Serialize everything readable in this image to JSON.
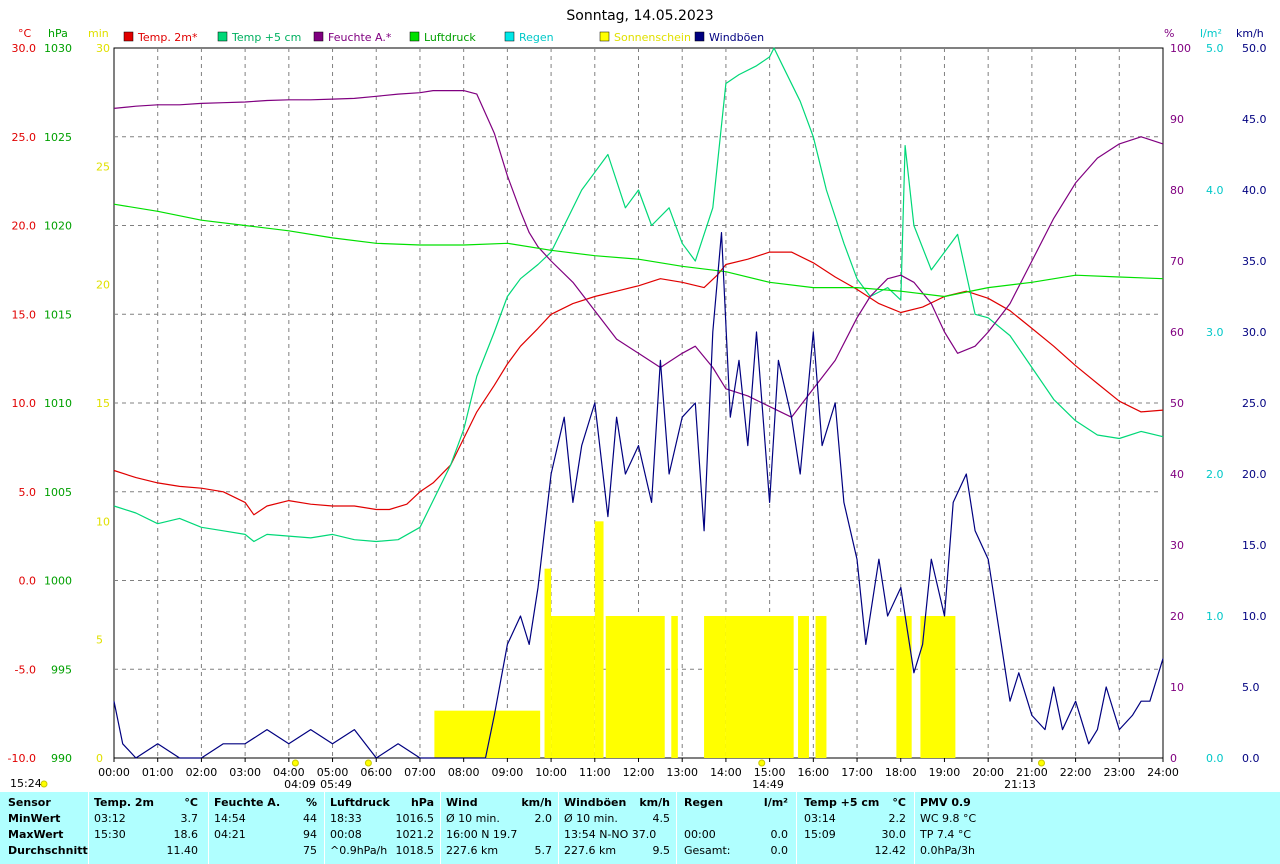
{
  "title": "Sonntag, 14.05.2023",
  "colors": {
    "temp": "#e00000",
    "temp5": "#00d878",
    "humidity": "#800080",
    "pressure": "#00e000",
    "rain": "#00e0e0",
    "sun": "#ffff00",
    "gust": "#000080",
    "min": "#e0e000",
    "grid": "#808080"
  },
  "axis_labels": {
    "temp": "°C",
    "pressure": "hPa",
    "sun": "min",
    "humidity": "%",
    "rain": "l/m²",
    "wind": "km/h"
  },
  "legend": [
    {
      "label": "Temp. 2m*",
      "color": "#e00000",
      "text_color": "#e00000"
    },
    {
      "label": "Temp +5 cm",
      "color": "#00d878",
      "text_color": "#00b060"
    },
    {
      "label": "Feuchte A.*",
      "color": "#800080",
      "text_color": "#800080"
    },
    {
      "label": "Luftdruck",
      "color": "#00e000",
      "text_color": "#00a000"
    },
    {
      "label": "Regen",
      "color": "#00e8e8",
      "text_color": "#00c8c8"
    },
    {
      "label": "Sonnenschein",
      "color": "#ffff00",
      "text_color": "#e0e000"
    },
    {
      "label": "Windböen",
      "color": "#000080",
      "text_color": "#000080"
    }
  ],
  "left_time_label": "15:24",
  "astro_labels": [
    "04:09",
    "05:49",
    "14:49",
    "21:13"
  ],
  "chart_data": {
    "type": "line",
    "title": "Sonntag, 14.05.2023",
    "x_ticks": [
      "00:00",
      "01:00",
      "02:00",
      "03:00",
      "04:00",
      "05:00",
      "06:00",
      "07:00",
      "08:00",
      "09:00",
      "10:00",
      "11:00",
      "12:00",
      "13:00",
      "14:00",
      "15:00",
      "16:00",
      "17:00",
      "18:00",
      "19:00",
      "20:00",
      "21:00",
      "22:00",
      "23:00",
      "24:00"
    ],
    "x_range_hours": [
      0,
      24
    ],
    "grid": true,
    "legend_position": "top",
    "axes": {
      "temp": {
        "unit": "°C",
        "range": [
          -10,
          30
        ],
        "ticks": [
          "30.0",
          "25.0",
          "20.0",
          "15.0",
          "10.0",
          "5.0",
          "0.0",
          "-5.0",
          "-10.0"
        ]
      },
      "pressure": {
        "unit": "hPa",
        "range": [
          990,
          1030
        ],
        "ticks": [
          "1030",
          "1025",
          "1020",
          "1015",
          "1010",
          "1005",
          "1000",
          "995",
          "990"
        ]
      },
      "sun": {
        "unit": "min",
        "range": [
          0,
          30
        ],
        "ticks": [
          "30",
          "25",
          "20",
          "15",
          "10",
          "5",
          "0"
        ]
      },
      "humidity": {
        "unit": "%",
        "range": [
          0,
          100
        ],
        "ticks": [
          "100",
          "90",
          "80",
          "70",
          "60",
          "50",
          "40",
          "30",
          "20",
          "10",
          "0"
        ]
      },
      "rain": {
        "unit": "l/m²",
        "range": [
          0,
          5
        ],
        "ticks": [
          "5.0",
          "4.0",
          "3.0",
          "2.0",
          "1.0",
          "0.0"
        ]
      },
      "wind": {
        "unit": "km/h",
        "range": [
          0,
          50
        ],
        "ticks": [
          "50.0",
          "45.0",
          "40.0",
          "35.0",
          "30.0",
          "25.0",
          "20.0",
          "15.0",
          "10.0",
          "5.0",
          "0.0"
        ]
      }
    },
    "series": [
      {
        "name": "Temp. 2m*",
        "axis": "temp",
        "hours": [
          0,
          0.5,
          1,
          1.5,
          2,
          2.5,
          3,
          3.2,
          3.5,
          4,
          4.5,
          5,
          5.5,
          6,
          6.3,
          6.7,
          7,
          7.3,
          7.7,
          8,
          8.3,
          8.7,
          9,
          9.3,
          9.7,
          10,
          10.5,
          11,
          11.5,
          12,
          12.5,
          13,
          13.5,
          13.8,
          14,
          14.5,
          15,
          15.5,
          16,
          16.5,
          17,
          17.5,
          18,
          18.5,
          19,
          19.5,
          20,
          20.5,
          21,
          21.5,
          22,
          22.5,
          23,
          23.5,
          24
        ],
        "values": [
          6.2,
          5.8,
          5.5,
          5.3,
          5.2,
          5,
          4.4,
          3.7,
          4.2,
          4.5,
          4.3,
          4.2,
          4.2,
          4.0,
          4.0,
          4.3,
          5.0,
          5.5,
          6.5,
          8,
          9.5,
          11,
          12.2,
          13.2,
          14.2,
          15,
          15.6,
          16,
          16.3,
          16.6,
          17,
          16.8,
          16.5,
          17.2,
          17.8,
          18.1,
          18.5,
          18.5,
          17.9,
          17.1,
          16.4,
          15.6,
          15.1,
          15.4,
          16,
          16.3,
          15.9,
          15.2,
          14.2,
          13.2,
          12.1,
          11.1,
          10.1,
          9.5,
          9.6
        ]
      },
      {
        "name": "Temp +5 cm",
        "axis": "temp",
        "hours": [
          0,
          0.5,
          1,
          1.5,
          2,
          2.5,
          3,
          3.2,
          3.5,
          4,
          4.5,
          5,
          5.5,
          6,
          6.5,
          7,
          7.3,
          7.7,
          8,
          8.3,
          8.7,
          9,
          9.3,
          9.7,
          10,
          10.3,
          10.7,
          11,
          11.3,
          11.7,
          12,
          12.3,
          12.7,
          13,
          13.3,
          13.7,
          14,
          14.3,
          14.7,
          15,
          15.1,
          15.3,
          15.7,
          16,
          16.3,
          16.7,
          17,
          17.3,
          17.7,
          18,
          18.1,
          18.3,
          18.7,
          19,
          19.3,
          19.7,
          20,
          20.5,
          21,
          21.5,
          22,
          22.5,
          23,
          23.5,
          24
        ],
        "values": [
          4.2,
          3.8,
          3.2,
          3.5,
          3.0,
          2.8,
          2.6,
          2.2,
          2.6,
          2.5,
          2.4,
          2.6,
          2.3,
          2.2,
          2.3,
          3.0,
          4.5,
          6.5,
          8.5,
          11.5,
          14,
          16,
          17,
          17.8,
          18.5,
          20,
          22,
          23,
          24,
          21,
          22,
          20,
          21,
          19,
          18,
          21,
          28,
          28.5,
          29,
          29.5,
          30,
          29,
          27,
          25,
          22,
          19,
          17,
          16,
          16.5,
          15.8,
          24.5,
          20,
          17.5,
          18.5,
          19.5,
          15,
          14.8,
          13.8,
          12.0,
          10.2,
          9.0,
          8.2,
          8.0,
          8.4,
          8.1
        ]
      },
      {
        "name": "Feuchte A.*",
        "axis": "humidity",
        "hours": [
          0,
          0.5,
          1,
          1.5,
          2,
          2.5,
          3,
          3.5,
          4,
          4.5,
          5,
          5.5,
          6,
          6.5,
          7,
          7.3,
          7.7,
          8,
          8.3,
          8.7,
          9,
          9.3,
          9.5,
          9.7,
          10,
          10.5,
          11,
          11.5,
          12,
          12.5,
          13,
          13.3,
          13.7,
          14,
          14.5,
          15,
          15.5,
          16,
          16.5,
          17,
          17.3,
          17.7,
          18,
          18.3,
          18.7,
          19,
          19.3,
          19.7,
          20,
          20.5,
          21,
          21.5,
          22,
          22.5,
          23,
          23.5,
          24
        ],
        "values": [
          91.5,
          91.8,
          92,
          92,
          92.2,
          92.3,
          92.4,
          92.6,
          92.7,
          92.7,
          92.8,
          92.9,
          93.2,
          93.5,
          93.7,
          94,
          94,
          94,
          93.5,
          88,
          82,
          77,
          74,
          72,
          70,
          67,
          63,
          59,
          57,
          55,
          57,
          58,
          55,
          52,
          51,
          49.5,
          48,
          52,
          56,
          62,
          65,
          67.5,
          68,
          67,
          64,
          60,
          57,
          58,
          60,
          64,
          70,
          76,
          81,
          84.5,
          86.5,
          87.5,
          86.5
        ]
      },
      {
        "name": "Luftdruck",
        "axis": "pressure",
        "hours": [
          0,
          1,
          2,
          3,
          4,
          5,
          6,
          7,
          8,
          9,
          10,
          11,
          12,
          13,
          14,
          15,
          16,
          17,
          18,
          19,
          20,
          21,
          22,
          23,
          24
        ],
        "values": [
          1021.2,
          1020.8,
          1020.3,
          1020,
          1019.7,
          1019.3,
          1019,
          1018.9,
          1018.9,
          1019,
          1018.6,
          1018.3,
          1018.1,
          1017.7,
          1017.4,
          1016.8,
          1016.5,
          1016.5,
          1016.3,
          1016,
          1016.5,
          1016.8,
          1017.2,
          1017.1,
          1017
        ]
      },
      {
        "name": "Windböen",
        "axis": "wind",
        "hours": [
          0,
          0.2,
          0.5,
          1,
          1.5,
          2,
          2.5,
          3,
          3.5,
          4,
          4.5,
          5,
          5.5,
          6,
          6.5,
          7,
          7.5,
          8,
          8.5,
          8.7,
          9,
          9.3,
          9.5,
          9.7,
          10,
          10.3,
          10.5,
          10.7,
          11,
          11.3,
          11.5,
          11.7,
          12,
          12.3,
          12.5,
          12.7,
          13,
          13.3,
          13.5,
          13.7,
          13.9,
          14.1,
          14.3,
          14.5,
          14.7,
          15,
          15.2,
          15.5,
          15.7,
          16,
          16.2,
          16.5,
          16.7,
          17,
          17.2,
          17.5,
          17.7,
          18,
          18.3,
          18.5,
          18.7,
          19,
          19.2,
          19.5,
          19.7,
          20,
          20.3,
          20.5,
          20.7,
          21,
          21.3,
          21.5,
          21.7,
          22,
          22.3,
          22.5,
          22.7,
          23,
          23.3,
          23.5,
          23.7,
          24
        ],
        "values": [
          4,
          1,
          0,
          1,
          0,
          0,
          1,
          1,
          2,
          1,
          2,
          1,
          2,
          0,
          1,
          0,
          0,
          0,
          0,
          3,
          8,
          10,
          8,
          12,
          20,
          24,
          18,
          22,
          25,
          17,
          24,
          20,
          22,
          18,
          28,
          20,
          24,
          25,
          16,
          30,
          37,
          24,
          28,
          22,
          30,
          18,
          28,
          24,
          20,
          30,
          22,
          25,
          18,
          14,
          8,
          14,
          10,
          12,
          6,
          8,
          14,
          10,
          18,
          20,
          16,
          14,
          8,
          4,
          6,
          3,
          2,
          5,
          2,
          4,
          1,
          2,
          5,
          2,
          3,
          4,
          4,
          7
        ]
      }
    ],
    "sunshine_bars": [
      {
        "from": 7.33,
        "to": 9.75,
        "minutes": 2
      },
      {
        "from": 9.85,
        "to": 10.0,
        "minutes": 8
      },
      {
        "from": 10.0,
        "to": 11.0,
        "minutes": 6
      },
      {
        "from": 11.0,
        "to": 11.2,
        "minutes": 10
      },
      {
        "from": 11.25,
        "to": 12.6,
        "minutes": 6
      },
      {
        "from": 12.75,
        "to": 12.9,
        "minutes": 6
      },
      {
        "from": 13.5,
        "to": 14.0,
        "minutes": 6
      },
      {
        "from": 14.0,
        "to": 15.55,
        "minutes": 6
      },
      {
        "from": 15.65,
        "to": 15.9,
        "minutes": 6
      },
      {
        "from": 16.05,
        "to": 16.3,
        "minutes": 6
      },
      {
        "from": 17.9,
        "to": 18.25,
        "minutes": 6
      },
      {
        "from": 18.45,
        "to": 19.25,
        "minutes": 6
      }
    ]
  },
  "stats": {
    "rows": [
      [
        "Sensor",
        "Temp. 2m",
        "°C",
        "Feuchte A.",
        "%",
        "Luftdruck",
        "hPa",
        "Wind",
        "km/h",
        "Windböen",
        "km/h",
        "Regen",
        "l/m²",
        "Temp +5 cm",
        "°C",
        "PMV 0.9"
      ],
      [
        "MinWert",
        "03:12",
        "3.7",
        "14:54",
        "44",
        "18:33",
        "1016.5",
        "Ø 10 min.",
        "2.0",
        "Ø 10 min.",
        "4.5",
        "",
        "",
        "03:14",
        "2.2",
        "WC 9.8 °C"
      ],
      [
        "MaxWert",
        "15:30",
        "18.6",
        "04:21",
        "94",
        "00:08",
        "1021.2",
        "16:00     N 19.7",
        "",
        "13:54   N-NO 37.0",
        "",
        "00:00",
        "0.0",
        "15:09",
        "30.0",
        "TP 7.4 °C"
      ],
      [
        "Durchschnitt",
        "",
        "11.40",
        "",
        "75",
        "^0.9hPa/h",
        "1018.5",
        "227.6 km",
        "5.7",
        "227.6 km",
        "9.5",
        "Gesamt:",
        "0.0",
        "",
        "12.42",
        "0.0hPa/3h"
      ]
    ]
  }
}
